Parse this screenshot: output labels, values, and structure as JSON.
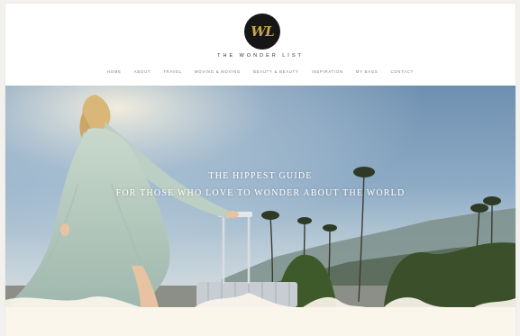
{
  "header": {
    "logo_monogram": "WL",
    "brand_name": "THE WONDER LIST",
    "nav": [
      "HOME",
      "ABOUT",
      "TRAVEL",
      "MOVING & MOVING",
      "BEAUTY & BEAUTY",
      "INSPIRATION",
      "MY BAGS",
      "CONTACT"
    ]
  },
  "hero": {
    "title_line1": "THE HIPPEST GUIDE",
    "title_line2": "FOR THOSE WHO LOVE TO WONDER ABOUT THE WORLD"
  },
  "colors": {
    "logo_bg": "#161616",
    "logo_gold": "#c9a44c",
    "sky": "#8dabc5",
    "band": "#fbf6ec"
  }
}
